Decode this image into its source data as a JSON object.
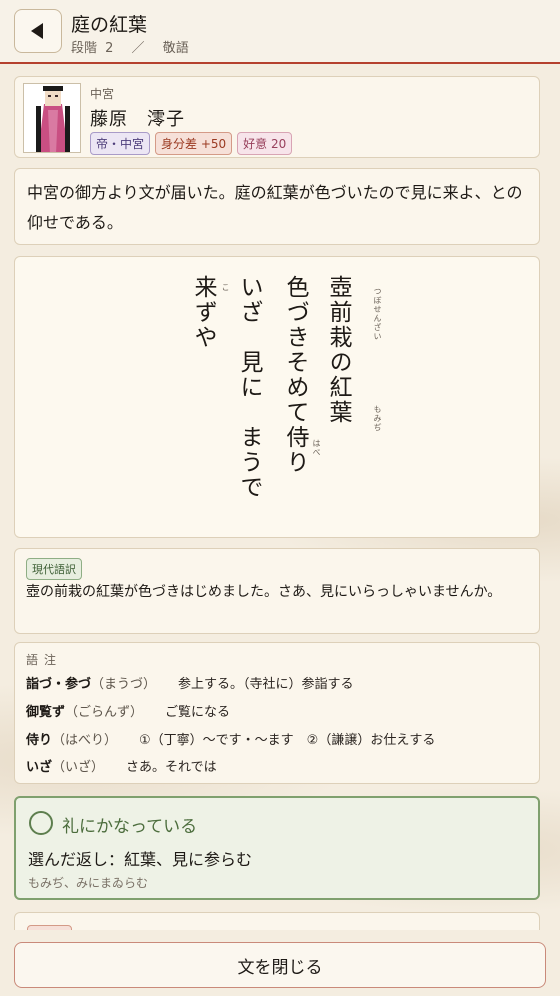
{
  "header": {
    "back_icon": "back-arrow-icon",
    "title": "庭の紅葉",
    "stage": "段階 2",
    "separator": "／",
    "category": "敬語"
  },
  "sender": {
    "rank": "中宮",
    "name": "藤原　澪子",
    "tags": [
      "帝・中宮",
      "身分差 +50",
      "好意 20"
    ],
    "portrait_icon": "court-lady-portrait-icon"
  },
  "message": "中宮の御方より文が届いた。庭の紅葉が色づいたので見に来よ、との仰せである。",
  "poem": {
    "lines": [
      "壺前栽の紅葉",
      "色づきそめて侍り",
      "いざ　見に　まうで",
      "来ずや"
    ],
    "ruby": {
      "tsubosenzai": "つぼせんざい",
      "momiji": "もみぢ",
      "haberi": "はべ",
      "ko": "こ"
    }
  },
  "translation": {
    "label": "現代語訳",
    "text": "壺の前栽の紅葉が色づきはじめました。さあ、見にいらっしゃいませんか。"
  },
  "notes": {
    "title": "語注",
    "items": [
      {
        "word": "詣づ・参づ",
        "reading": "（まうづ）",
        "meaning": "参上する。（寺社に）参詣する"
      },
      {
        "word": "御覧ず",
        "reading": "（ごらんず）",
        "meaning": "ご覧になる"
      },
      {
        "word": "侍り",
        "reading": "（はべり）",
        "meaning": "①（丁寧）〜です・〜ます　②（謙譲）お仕えする"
      },
      {
        "word": "いざ",
        "reading": "（いざ）",
        "meaning": "さあ。それでは"
      }
    ]
  },
  "result": {
    "status_icon": "circle-icon",
    "status": "礼にかなっている",
    "reply": "選んだ返し：紅葉、見に参らむ",
    "reading": "もみぢ、みにまゐらむ"
  },
  "peek_tag": "巨　歩",
  "footer": {
    "close_label": "文を閉じる"
  },
  "colors": {
    "accent": "#b5412e",
    "success": "#7fa06e",
    "background": "#f4ede0"
  }
}
